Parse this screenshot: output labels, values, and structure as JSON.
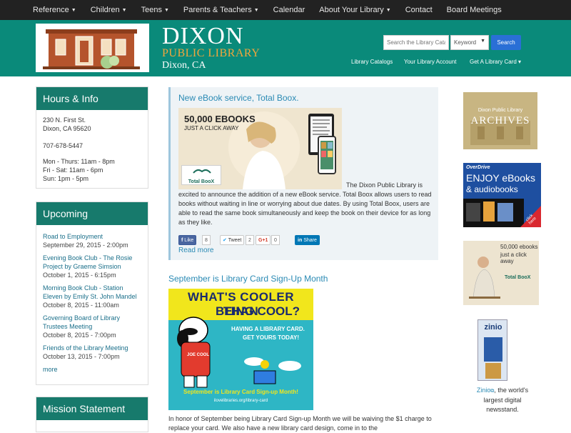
{
  "top_nav": [
    {
      "label": "Reference",
      "caret": true
    },
    {
      "label": "Children",
      "caret": true
    },
    {
      "label": "Teens",
      "caret": true
    },
    {
      "label": "Parents & Teachers",
      "caret": true
    },
    {
      "label": "Calendar",
      "caret": false
    },
    {
      "label": "About Your Library",
      "caret": true
    },
    {
      "label": "Contact",
      "caret": false
    },
    {
      "label": "Board Meetings",
      "caret": false
    }
  ],
  "header": {
    "name": "DIXON",
    "subtitle": "PUBLIC LIBRARY",
    "city": "Dixon, CA",
    "search_placeholder": "Search the Library Catalog",
    "search_type": "Keyword",
    "search_button": "Search",
    "links": [
      "Library Catalogs",
      "Your Library Account",
      "Get A Library Card ▾"
    ]
  },
  "hours": {
    "title": "Hours & Info",
    "address1": "230 N. First St.",
    "address2": "Dixon, CA  95620",
    "phone": "707-678-5447",
    "hours": [
      "Mon - Thurs: 11am - 8pm",
      "Fri - Sat: 11am - 6pm",
      "Sun: 1pm - 5pm"
    ]
  },
  "upcoming": {
    "title": "Upcoming",
    "events": [
      {
        "title": "Road to Employment",
        "date": "September 29, 2015 - 2:00pm"
      },
      {
        "title": "Evening Book Club - The Rosie Project by Graeme Simsion",
        "date": "October 1, 2015 - 6:15pm"
      },
      {
        "title": "Morning Book Club - Station Eleven by Emily St. John Mandel",
        "date": "October 8, 2015 - 11:00am"
      },
      {
        "title": "Governing Board of Library Trustees Meeting",
        "date": "October 8, 2015 - 7:00pm"
      },
      {
        "title": "Friends of the Library Meeting",
        "date": "October 13, 2015 - 7:00pm"
      }
    ],
    "more": "more"
  },
  "mission": {
    "title": "Mission Statement"
  },
  "post1": {
    "title": "New eBook service, Total Boox.",
    "img_headline": "50,000 EBOOKS",
    "img_sub": "JUST A CLICK AWAY",
    "img_brand": "Total BooX",
    "body_inline": "The Dixon Public Library is",
    "body": "excited to announce the addition of a new eBook service. Total Boox allows users to read books without waiting in line or worrying about due dates. By using Total Boox, users are able to read the same book simultaneously and keep the book on their device for as long as they like.",
    "like": "Like",
    "like_count": "8",
    "tweet": "Tweet",
    "tweet_count": "2",
    "gplus": "G+1",
    "gplus_count": "0",
    "share": "Share",
    "read_more": "Read more"
  },
  "post2": {
    "title": "September is Library Card Sign-Up Month",
    "img_line1": "WHAT'S COOLER THAN",
    "img_line2": "BEING COOL?",
    "img_line3": "HAVING A LIBRARY CARD.",
    "img_line4": "GET YOURS TODAY!",
    "img_line5": "September is Library Card Sign-up Month!",
    "img_url": "ilovelibraries.org/library-card",
    "img_badge": "JOE COOL",
    "body": "In honor of September being Library Card Sign-up Month we will be waiving the $1 charge to replace your card. We also have a new library card design, come in to the"
  },
  "ads": {
    "archives_top": "Dixon Public Library",
    "archives": "ARCHIVES",
    "overdrive_brand": "OverDrive",
    "overdrive_l1": "ENJOY eBooks",
    "overdrive_l2": "& audiobooks",
    "overdrive_click": "click here",
    "totalboox_l1": "50,000 ebooks",
    "totalboox_l2": "just a click away",
    "totalboox_brand": "Total BooX",
    "zinio_brand": "zinio",
    "zinio_link": "Zinio",
    "zinio_text1": ", the world's",
    "zinio_text2": "largest digital",
    "zinio_text3": "newsstand."
  },
  "colors": {
    "teal": "#0a8a7a",
    "panel_head": "#177a6c",
    "link": "#2a8ab4",
    "orange": "#f2a63c"
  }
}
